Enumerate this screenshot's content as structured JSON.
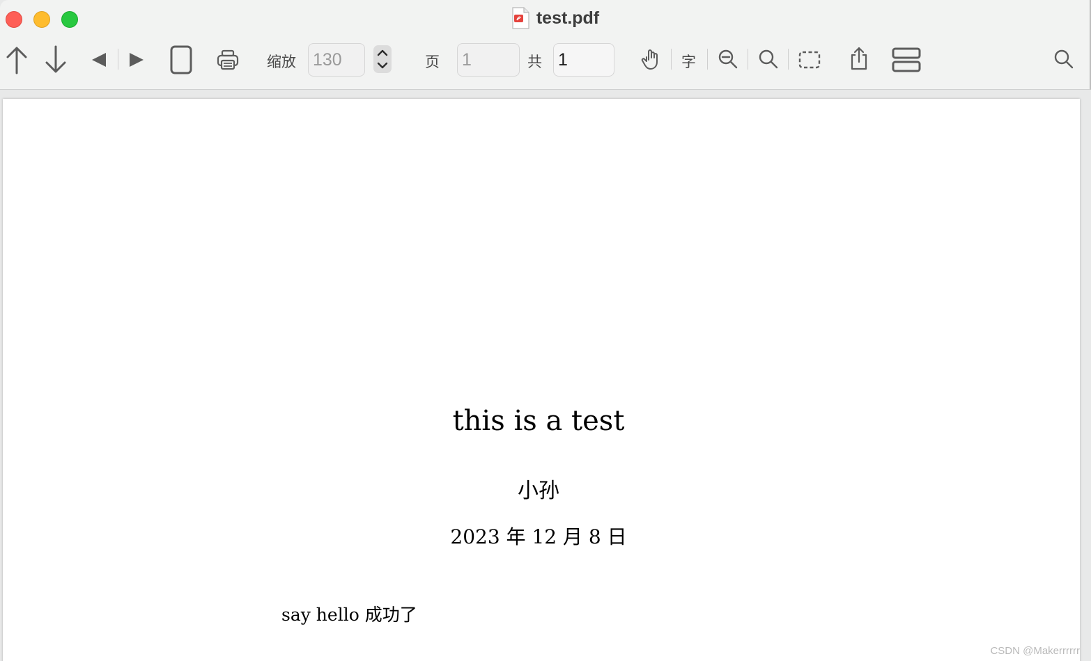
{
  "window": {
    "title": "test.pdf",
    "title_icon": "pdf-file-icon"
  },
  "toolbar": {
    "zoom_label": "缩放",
    "zoom_value": "130",
    "page_label": "页",
    "page_value": "1",
    "total_label": "共",
    "total_value": "1",
    "text_tool_label": "字",
    "icons": [
      "arrow-up-icon",
      "arrow-down-icon",
      "triangle-left-icon",
      "triangle-right-icon",
      "single-page-icon",
      "print-icon",
      "stepper-icon",
      "hand-icon",
      "zoom-out-icon",
      "zoom-icon",
      "selection-rect-icon",
      "share-icon",
      "continuous-pages-icon",
      "search-icon"
    ]
  },
  "document": {
    "title": "this is a test",
    "author": "小孙",
    "date": "2023 年 12 月 8 日",
    "body": "say hello 成功了"
  },
  "watermark": "CSDN @Makerrrrrr",
  "colors": {
    "close": "#fe5f57",
    "minimize": "#febc2e",
    "maximize": "#28c840",
    "toolbar_bg": "#f2f3f2"
  }
}
